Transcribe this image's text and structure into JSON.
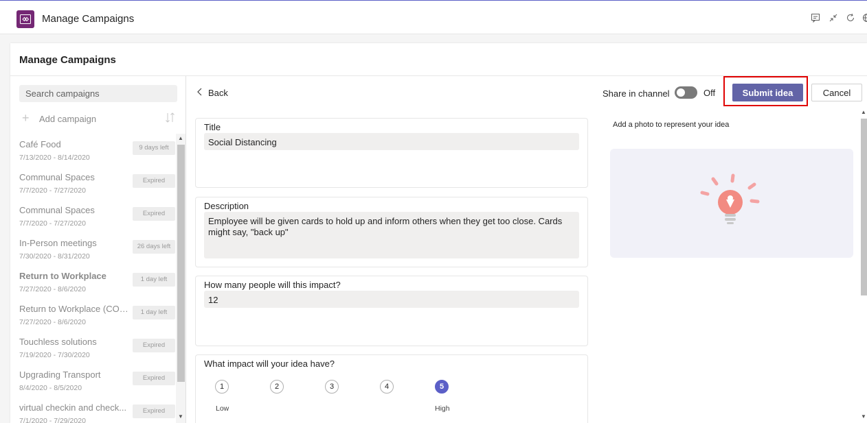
{
  "app": {
    "title": "Manage Campaigns",
    "icon": "power-apps-icon",
    "accent": "#742774"
  },
  "toolbar_icons": [
    "chat-icon",
    "collapse-icon",
    "refresh-icon",
    "globe-icon"
  ],
  "panel": {
    "title": "Manage Campaigns"
  },
  "sidebar": {
    "search_placeholder": "Search campaigns",
    "add_label": "Add campaign",
    "campaigns": [
      {
        "name": "Café Food",
        "dates": "7/13/2020 - 8/14/2020",
        "badge": "9 days left",
        "bold": false
      },
      {
        "name": "Communal Spaces",
        "dates": "7/7/2020 - 7/27/2020",
        "badge": "Expired",
        "bold": false
      },
      {
        "name": "Communal Spaces",
        "dates": "7/7/2020 - 7/27/2020",
        "badge": "Expired",
        "bold": false
      },
      {
        "name": "In-Person meetings",
        "dates": "7/30/2020 - 8/31/2020",
        "badge": "26 days left",
        "bold": false
      },
      {
        "name": "Return to Workplace",
        "dates": "7/27/2020 - 8/6/2020",
        "badge": "1 day left",
        "bold": true
      },
      {
        "name": "Return to Workplace (COP...",
        "dates": "7/27/2020 - 8/6/2020",
        "badge": "1 day left",
        "bold": false
      },
      {
        "name": "Touchless solutions",
        "dates": "7/19/2020 - 7/30/2020",
        "badge": "Expired",
        "bold": false
      },
      {
        "name": "Upgrading Transport",
        "dates": "8/4/2020 - 8/5/2020",
        "badge": "Expired",
        "bold": false
      },
      {
        "name": "virtual checkin and check...",
        "dates": "7/1/2020 - 7/29/2020",
        "badge": "Expired",
        "bold": false
      }
    ]
  },
  "form": {
    "back_label": "Back",
    "title_label": "Title",
    "title_value": "Social Distancing",
    "description_label": "Description",
    "description_value": "Employee will be given cards to hold up and inform others when they get too close. Cards might say, \"back up\"",
    "people_label": "How many people will this impact?",
    "people_value": "12",
    "impact_label": "What impact will your idea have?",
    "impact_options": [
      "1",
      "2",
      "3",
      "4",
      "5"
    ],
    "impact_selected": "5",
    "impact_low": "Low",
    "impact_high": "High"
  },
  "actions": {
    "share_label": "Share in channel",
    "share_state": "Off",
    "submit_label": "Submit idea",
    "cancel_label": "Cancel",
    "submit_color": "#6264a7",
    "highlight_color": "#e00000"
  },
  "photo": {
    "label": "Add a photo to represent your idea",
    "icon": "lightbulb-icon"
  }
}
